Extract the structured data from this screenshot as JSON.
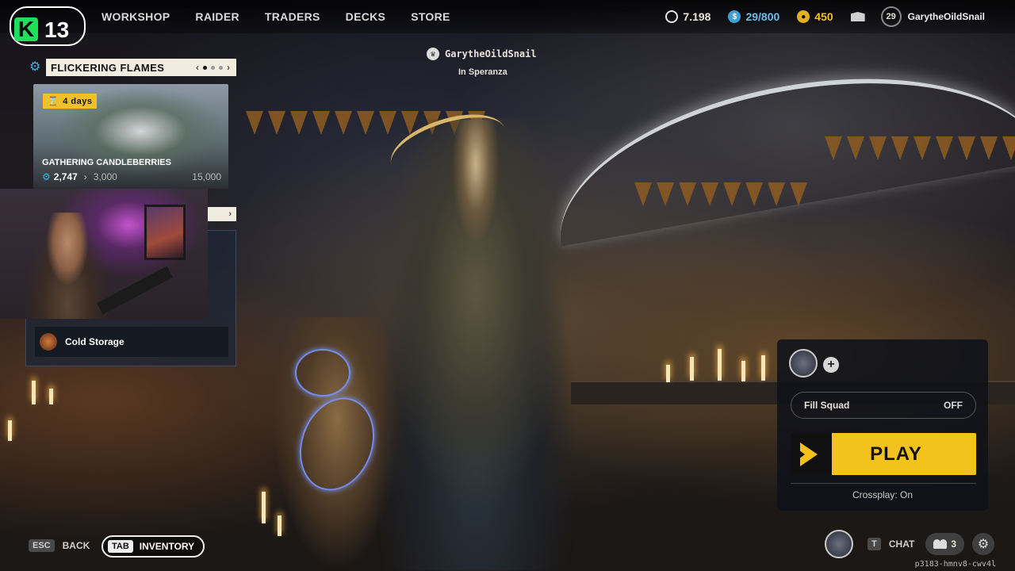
{
  "logo": {
    "letter": "K",
    "number": "13"
  },
  "nav": {
    "items": [
      {
        "label": "WORKSHOP"
      },
      {
        "label": "RAIDER"
      },
      {
        "label": "TRADERS"
      },
      {
        "label": "DECKS"
      },
      {
        "label": "STORE"
      }
    ]
  },
  "currencies": {
    "coins": "7.198",
    "credits": "29/800",
    "gold": "450"
  },
  "profile": {
    "level": "29",
    "username": "GarytheOildSnail"
  },
  "player_tag": {
    "name": "GarytheOildSnail",
    "location": "In Speranza"
  },
  "event": {
    "title": "FLICKERING FLAMES",
    "timer": "4 days",
    "card_title": "GATHERING CANDLEBERRIES",
    "progress_current": "2,747",
    "progress_next": "3,000",
    "progress_max": "15,000",
    "page_index": 1,
    "page_count": 3
  },
  "list": {
    "items": [
      {
        "label": "Cold Storage"
      }
    ]
  },
  "squad": {
    "fill_squad_label": "Fill Squad",
    "fill_squad_value": "OFF",
    "play_label": "PLAY",
    "crossplay": "Crossplay: On"
  },
  "bottom": {
    "back_key": "ESC",
    "back_label": "BACK",
    "inventory_key": "TAB",
    "inventory_label": "INVENTORY",
    "chat_key": "T",
    "chat_label": "CHAT",
    "friends_count": "3"
  },
  "session_id": "p3183-hmnv8-cwv4l",
  "colors": {
    "accent_yellow": "#f4c21d",
    "accent_blue": "#3fb0e8",
    "brand_green": "#1fe05a"
  },
  "icons": [
    "gear-icon",
    "coin-icon",
    "credits-icon",
    "gold-icon",
    "mail-icon",
    "crown-icon",
    "hourglass-icon",
    "friends-icon",
    "settings-icon",
    "play-icon",
    "plus-icon"
  ]
}
